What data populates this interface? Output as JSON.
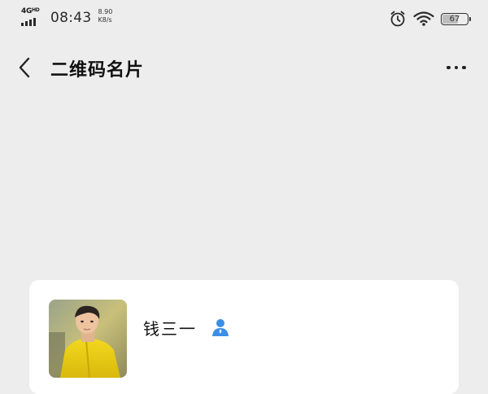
{
  "status_bar": {
    "network": "4G",
    "network_sub": "HD",
    "time": "08:43",
    "speed_value": "8.90",
    "speed_unit": "K8/s",
    "battery": "67",
    "icons": [
      "alarm-icon",
      "wifi-icon",
      "battery-icon"
    ]
  },
  "nav": {
    "title": "二维码名片",
    "back_icon": "chevron-left-icon",
    "more_icon": "more-dots-icon"
  },
  "card": {
    "name": "钱三一",
    "contact_icon": "person-icon",
    "contact_icon_color": "#3a8ee6"
  },
  "colors": {
    "background": "#ededed",
    "card": "#ffffff",
    "accent": "#3a8ee6"
  }
}
